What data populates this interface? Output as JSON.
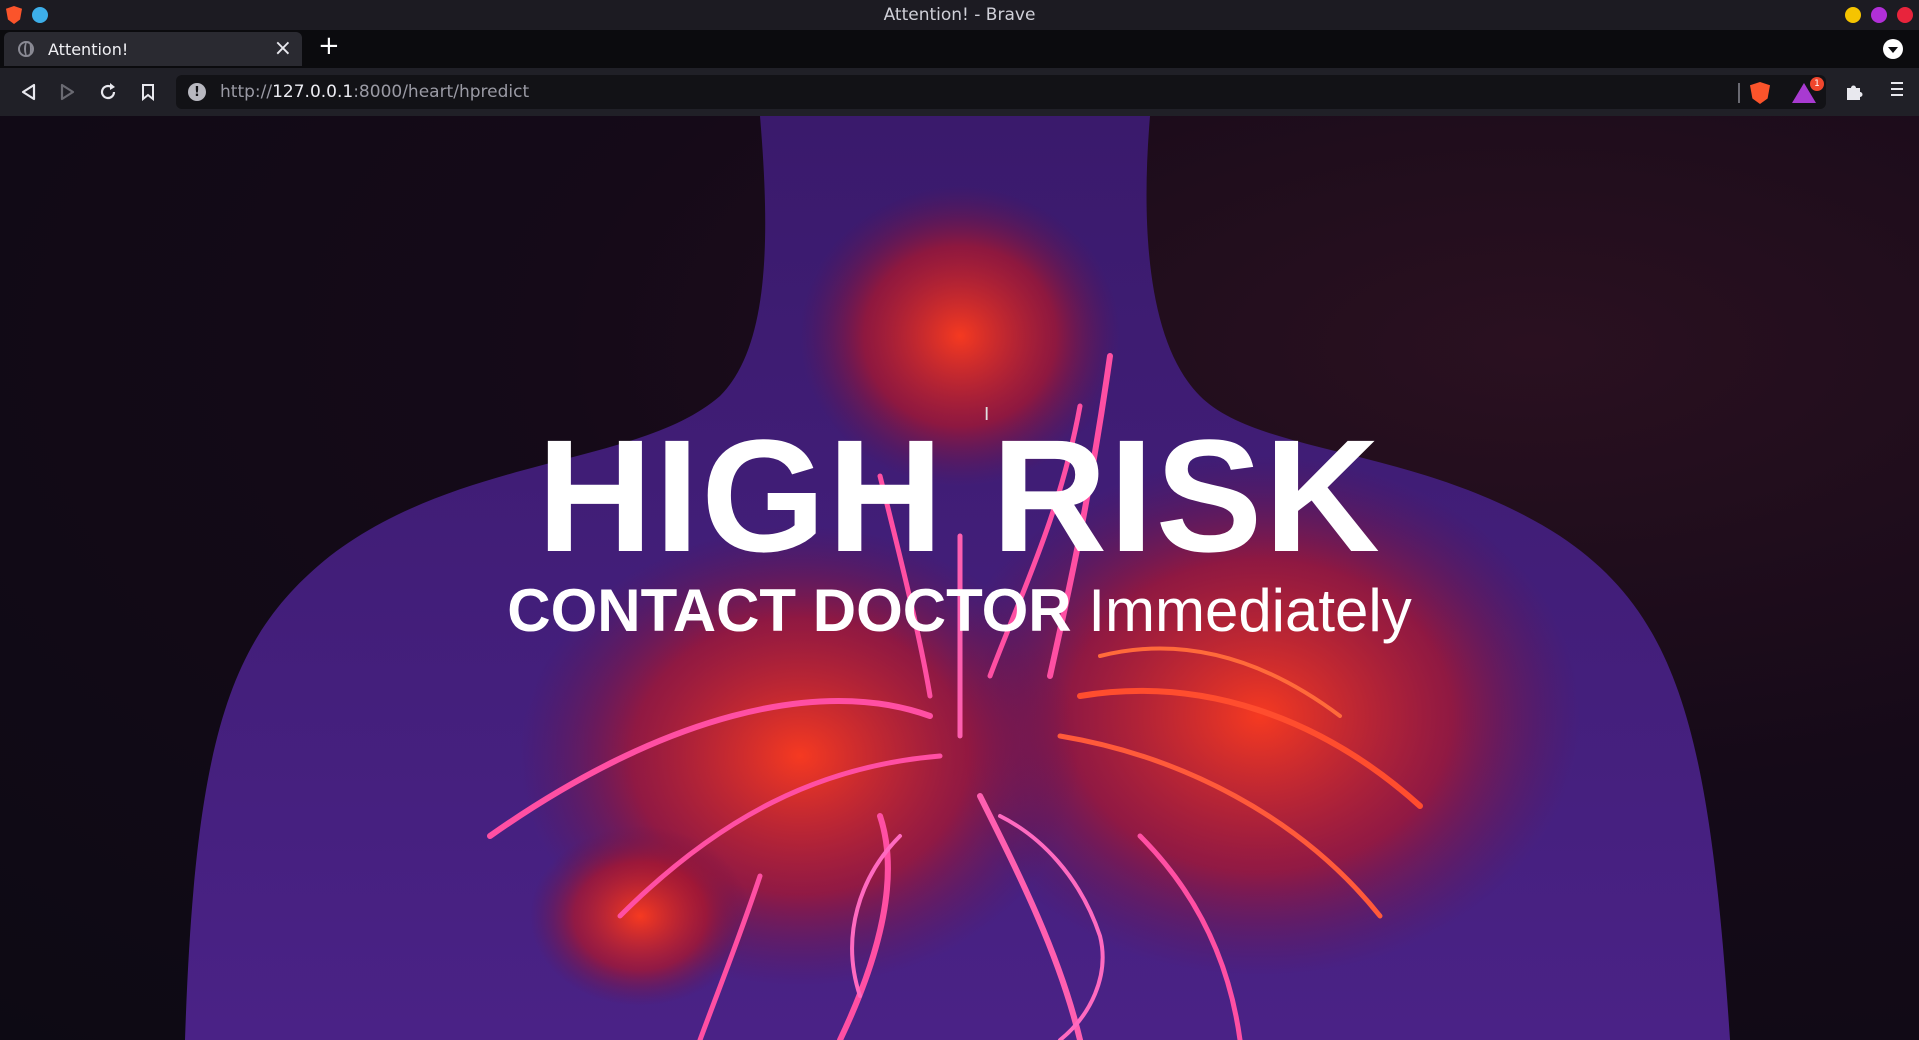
{
  "window": {
    "title": "Attention! - Brave"
  },
  "tabs": [
    {
      "label": "Attention!"
    }
  ],
  "address_bar": {
    "url_scheme": "http://",
    "url_host": "127.0.0.1",
    "url_path": ":8000/heart/hpredict"
  },
  "toolbar": {
    "rewards_badge": "1"
  },
  "page": {
    "headline": "HIGH RISK",
    "subline_strong": "CONTACT DOCTOR",
    "subline_light": "Immediately"
  },
  "colors": {
    "accent_red": "#fb542b",
    "rewards_purple": "#a83ad1",
    "win_min": "#f5c400",
    "win_max": "#b12fd8",
    "win_close": "#e8243c"
  },
  "icons": [
    "brave-lion-icon",
    "globe-icon",
    "close-icon",
    "plus-icon",
    "chevron-down-icon",
    "back-icon",
    "forward-icon",
    "reload-icon",
    "bookmark-icon",
    "info-icon",
    "brave-shield-icon",
    "rewards-icon",
    "extensions-icon",
    "menu-icon"
  ]
}
